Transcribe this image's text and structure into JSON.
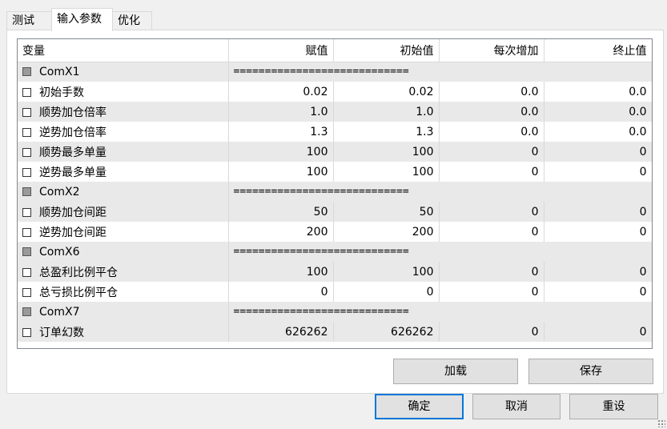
{
  "tabs": [
    {
      "label": "测试"
    },
    {
      "label": "输入参数"
    },
    {
      "label": "优化"
    }
  ],
  "grid": {
    "columns": [
      "变量",
      "赋值",
      "初始值",
      "每次增加",
      "终止值"
    ],
    "rows": [
      {
        "type": "group",
        "name": "ComX1",
        "sep": "============================"
      },
      {
        "type": "param",
        "name": "初始手数",
        "value": "0.02",
        "start": "0.02",
        "step": "0.0",
        "stop": "0.0"
      },
      {
        "type": "param",
        "name": "顺势加仓倍率",
        "value": "1.0",
        "start": "1.0",
        "step": "0.0",
        "stop": "0.0"
      },
      {
        "type": "param",
        "name": "逆势加仓倍率",
        "value": "1.3",
        "start": "1.3",
        "step": "0.0",
        "stop": "0.0"
      },
      {
        "type": "param",
        "name": "顺势最多单量",
        "value": "100",
        "start": "100",
        "step": "0",
        "stop": "0"
      },
      {
        "type": "param",
        "name": "逆势最多单量",
        "value": "100",
        "start": "100",
        "step": "0",
        "stop": "0"
      },
      {
        "type": "group",
        "name": "ComX2",
        "sep": "============================"
      },
      {
        "type": "param",
        "name": "顺势加仓间距",
        "value": "50",
        "start": "50",
        "step": "0",
        "stop": "0"
      },
      {
        "type": "param",
        "name": "逆势加仓间距",
        "value": "200",
        "start": "200",
        "step": "0",
        "stop": "0"
      },
      {
        "type": "group",
        "name": "ComX6",
        "sep": "============================"
      },
      {
        "type": "param",
        "name": "总盈利比例平仓",
        "value": "100",
        "start": "100",
        "step": "0",
        "stop": "0"
      },
      {
        "type": "param",
        "name": "总亏损比例平仓",
        "value": "0",
        "start": "0",
        "step": "0",
        "stop": "0"
      },
      {
        "type": "group",
        "name": "ComX7",
        "sep": "============================"
      },
      {
        "type": "param",
        "name": "订单幻数",
        "value": "626262",
        "start": "626262",
        "step": "0",
        "stop": "0"
      }
    ]
  },
  "buttons": {
    "load": "加载",
    "save": "保存",
    "ok": "确定",
    "cancel": "取消",
    "reset": "重设"
  },
  "colors": {
    "row_alt": "#e9e9e9",
    "accent": "#0078d7"
  }
}
